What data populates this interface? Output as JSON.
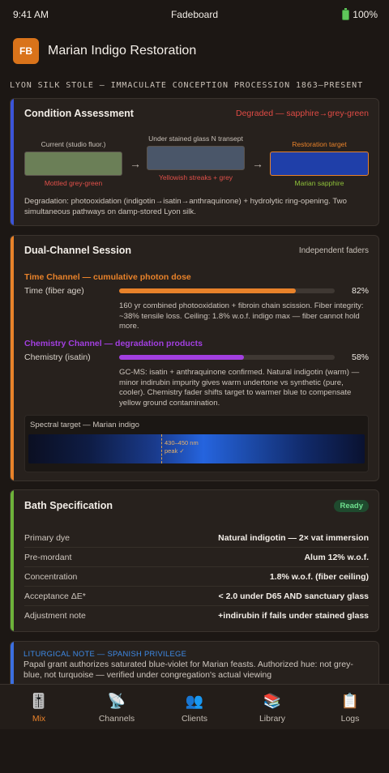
{
  "status_bar": {
    "time": "9:41 AM",
    "app_name": "Fadeboard",
    "battery": "100%"
  },
  "header": {
    "logo": "FB",
    "title": "Marian Indigo Restoration"
  },
  "subtitle": "LYON SILK STOLE — IMMACULATE CONCEPTION PROCESSION 1863–PRESENT",
  "condition": {
    "title": "Condition Assessment",
    "status": "Degraded — sapphire→grey-green",
    "status_color": "#e04b45",
    "swatches": [
      {
        "label": "Current (studio fluor.)",
        "caption": "Mottled grey-green",
        "color": "#6b7f57",
        "caption_color": "#e0504a"
      },
      {
        "label": "Under stained glass N transept",
        "caption": "Yellowish streaks + grey",
        "color": "#4a5669",
        "caption_color": "#e0504a"
      },
      {
        "label": "Restoration target",
        "caption": "Marian sapphire",
        "color": "#1f3fa9",
        "caption_color": "#8fc23a",
        "label_color": "#e8822a"
      }
    ],
    "arrow_glyph": "→",
    "description": "Degradation: photooxidation (indigotin→isatin→anthraquinone) + hydrolytic ring-opening. Two simultaneous pathways on damp-stored Lyon silk."
  },
  "session": {
    "title": "Dual-Channel Session",
    "right_label": "Independent faders",
    "time_channel": {
      "title": "Time Channel — cumulative photon dose",
      "color": "#e8822a",
      "fader_label": "Time (fiber age)",
      "value": 82,
      "value_label": "82%",
      "note": "160 yr combined photooxidation + fibroin chain scission. Fiber integrity: ~38% tensile loss. Ceiling: 1.8% w.o.f. indigo max — fiber cannot hold more."
    },
    "chemistry_channel": {
      "title": "Chemistry Channel — degradation products",
      "color": "#a23fe0",
      "fader_label": "Chemistry (isatin)",
      "value": 58,
      "value_label": "58%",
      "note": "GC-MS: isatin + anthraquinone confirmed. Natural indigotin (warm) — minor indirubin impurity gives warm undertone vs synthetic (pure, cooler). Chemistry fader shifts target to warmer blue to compensate yellow ground contamination."
    },
    "spectral": {
      "title": "Spectral target — Marian indigo",
      "peak_range": "430–450 nm",
      "peak_label": "peak ✓"
    }
  },
  "bath": {
    "title": "Bath Specification",
    "badge": "Ready",
    "rows": [
      {
        "key": "Primary dye",
        "value": "Natural indigotin — 2× vat immersion"
      },
      {
        "key": "Pre-mordant",
        "value": "Alum 12% w.o.f."
      },
      {
        "key": "Concentration",
        "value": "1.8% w.o.f. (fiber ceiling)"
      },
      {
        "key": "Acceptance ΔE*",
        "value": "< 2.0 under D65 AND sanctuary glass"
      },
      {
        "key": "Adjustment note",
        "value": "+indirubin if fails under stained glass"
      }
    ]
  },
  "liturgy": {
    "title": "LITURGICAL NOTE — SPANISH PRIVILEGE",
    "body": "Papal grant authorizes saturated blue-violet for Marian feasts. Authorized hue: not grey-blue, not turquoise — verified under congregation's actual viewing"
  },
  "tabs": [
    {
      "label": "Mix",
      "icon": "🎚️",
      "icon_name": "mixer-icon",
      "active": true
    },
    {
      "label": "Channels",
      "icon": "📡",
      "icon_name": "satellite-icon",
      "active": false
    },
    {
      "label": "Clients",
      "icon": "👥",
      "icon_name": "people-icon",
      "active": false
    },
    {
      "label": "Library",
      "icon": "📚",
      "icon_name": "books-icon",
      "active": false
    },
    {
      "label": "Logs",
      "icon": "📋",
      "icon_name": "clipboard-icon",
      "active": false
    }
  ],
  "colors": {
    "accent_condition": "#3b55d9",
    "accent_session": "#e8822a",
    "accent_bath": "#6db23a",
    "accent_liturgy": "#3b6fe0"
  }
}
